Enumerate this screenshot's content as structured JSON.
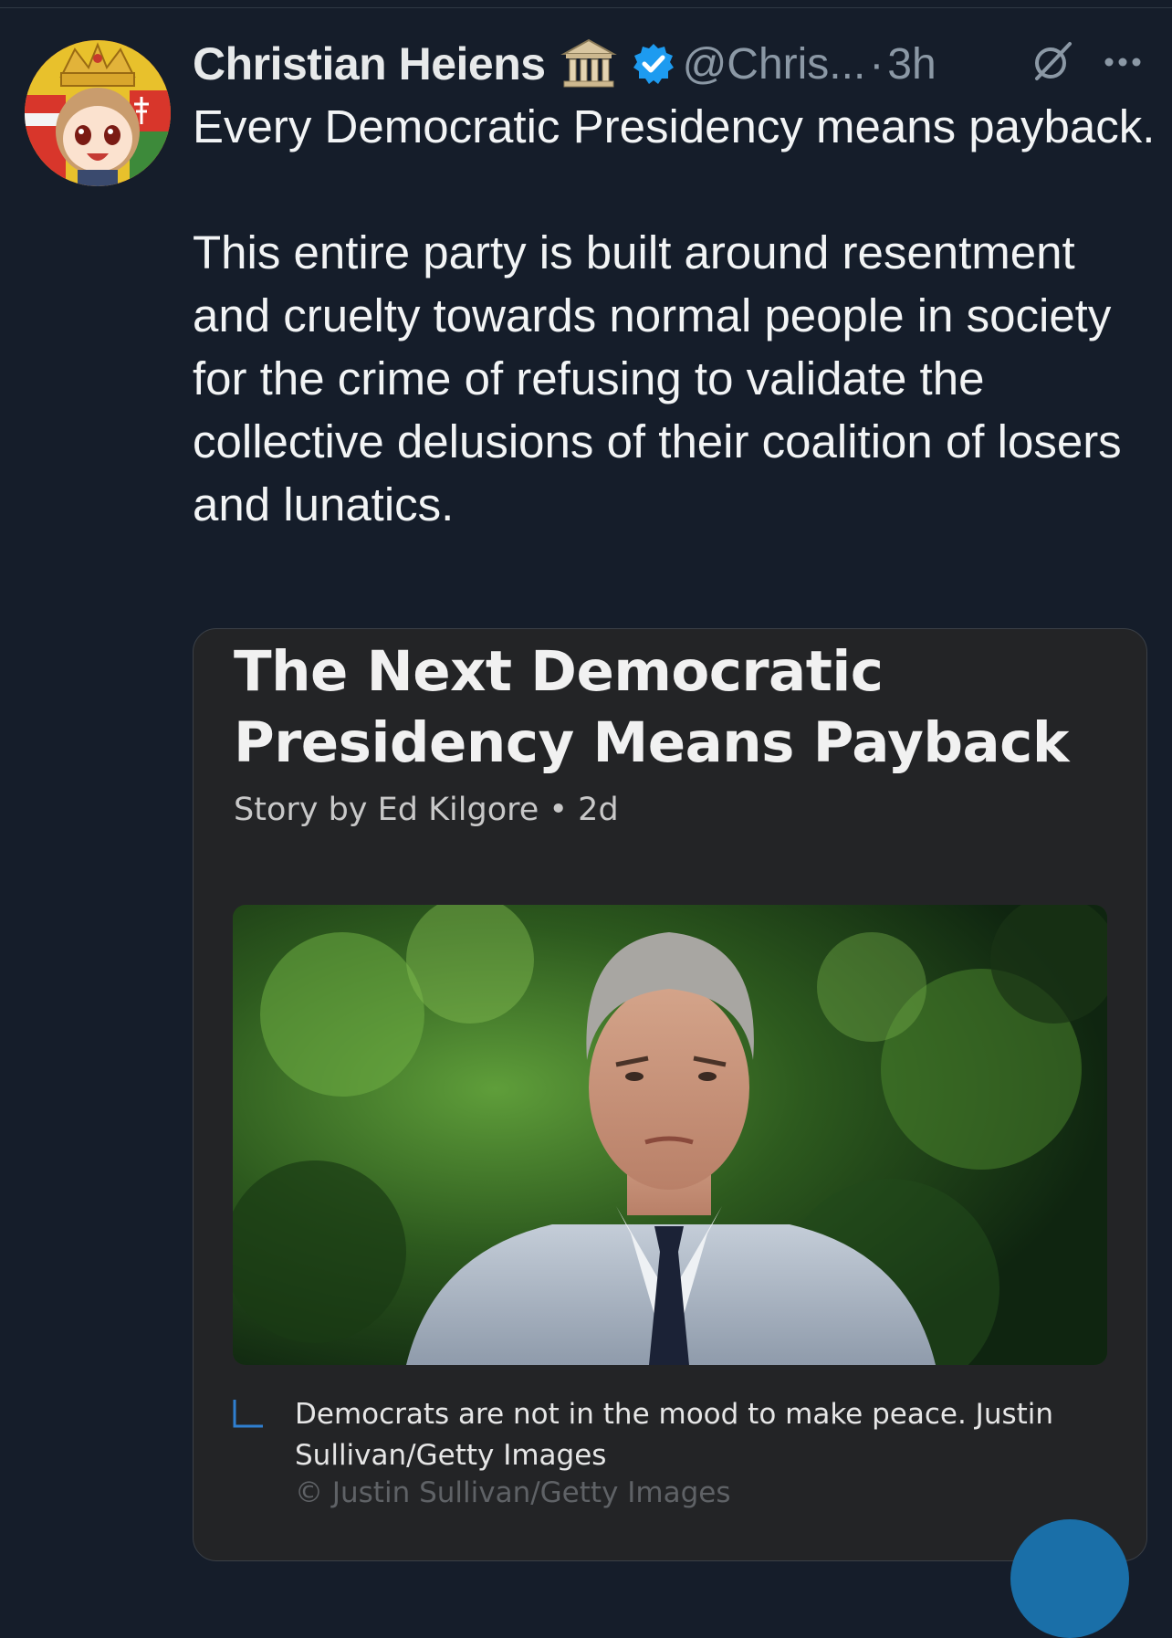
{
  "post": {
    "author": {
      "display_name": "Christian Heiens",
      "handle": "@Chris...",
      "separator": "·",
      "time": "3h",
      "badges": [
        "classical-building-icon",
        "verified-badge-icon"
      ]
    },
    "text": {
      "line1": "Every Democratic Presidency means payback.",
      "line2": "This entire party is built around resentment and cruelty towards normal people in society for the crime of refusing to validate the collective delusions of their coalition of losers and lunatics."
    },
    "actions": {
      "grok_icon": "grok-icon",
      "more_icon": "more-icon"
    }
  },
  "card": {
    "title": "The Next Democratic Presidency Means Payback",
    "byline": "Story by Ed Kilgore • 2d",
    "caption": "Democrats are not in the mood to make peace. Justin Sullivan/Getty Images",
    "credit": "© Justin Sullivan/Getty Images"
  },
  "colors": {
    "background": "#151d2a",
    "verified_blue": "#1d9bf0",
    "card_background": "#232426",
    "muted_text": "#8b98a5"
  }
}
